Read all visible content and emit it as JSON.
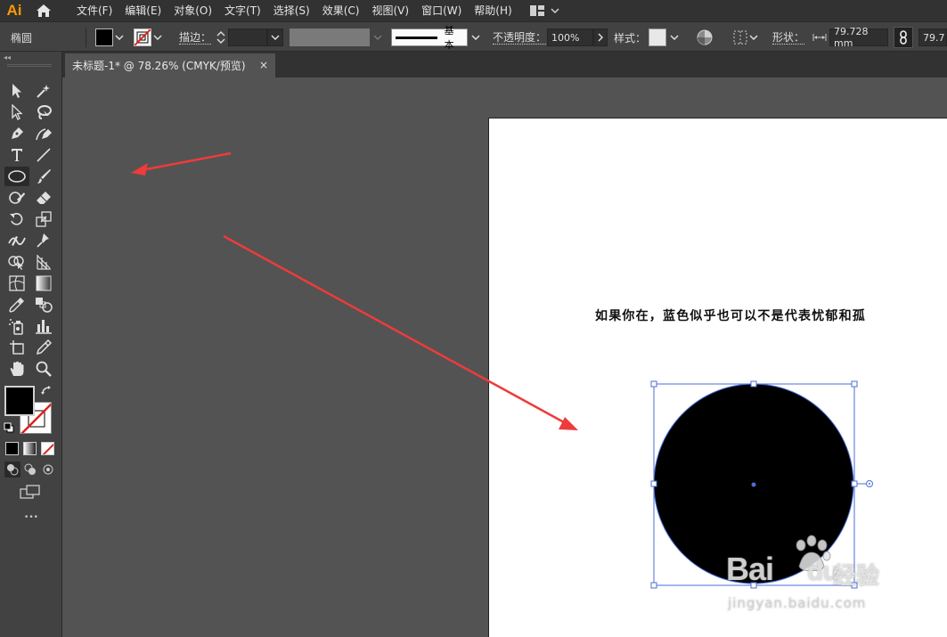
{
  "app": {
    "logo": "Ai"
  },
  "menu": [
    "文件(F)",
    "编辑(E)",
    "对象(O)",
    "文字(T)",
    "选择(S)",
    "效果(C)",
    "视图(V)",
    "窗口(W)",
    "帮助(H)"
  ],
  "control_bar": {
    "object_type": "椭圆",
    "stroke_label": "描边：",
    "stroke_weight": "",
    "brush_profile": "基本",
    "opacity_label": "不透明度：",
    "opacity_value": "100%",
    "style_label": "样式：",
    "shape_label": "形状：",
    "width_value": "79.728 mm",
    "height_value": "79.7"
  },
  "document_tab": {
    "title": "未标题-1* @ 78.26% (CMYK/预览)",
    "close": "×"
  },
  "artboard": {
    "text": "如果你在，蓝色似乎也可以不是代表忧郁和孤"
  },
  "toolbar": {
    "more": "•••"
  },
  "watermark": {
    "brand": "Bai",
    "brand_suffix": "du",
    "cn": "经验",
    "url": "jingyan.baidu.com"
  },
  "colors": {
    "accent": "#ff9a00",
    "selection": "#4a6fd8",
    "arrow": "#ee3b3b",
    "fill": "#000000"
  }
}
